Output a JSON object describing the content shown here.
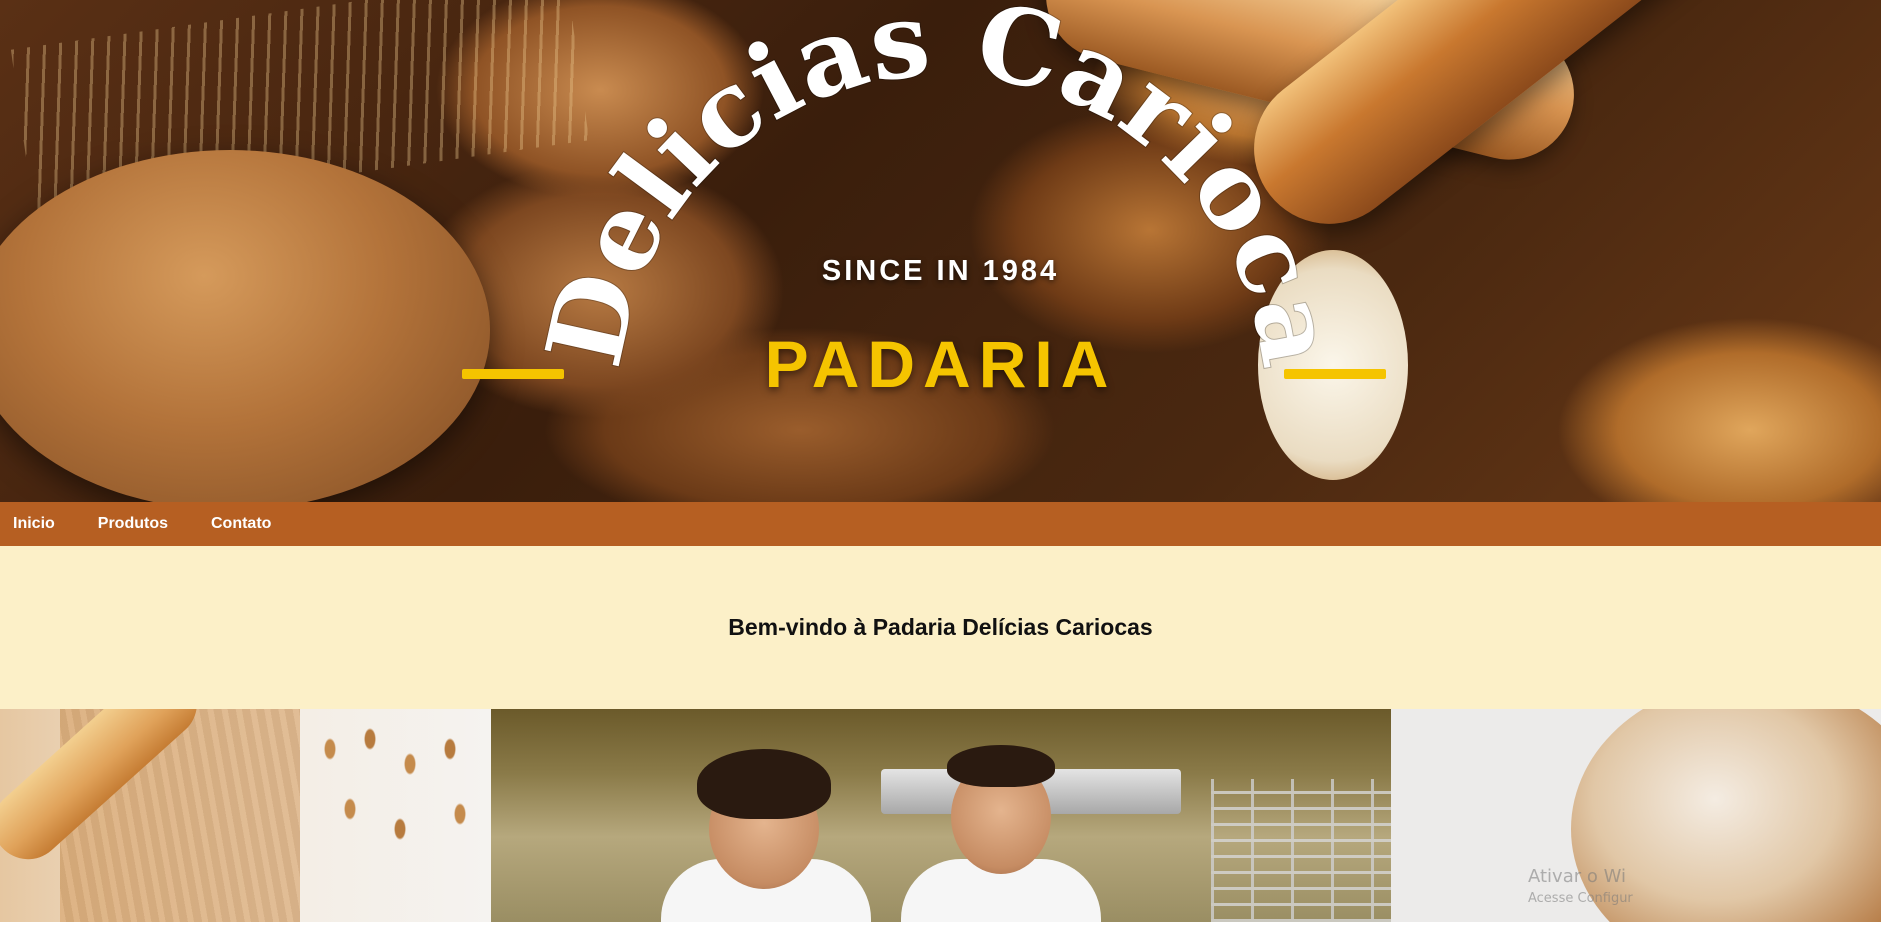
{
  "hero": {
    "brand_arc": "Delicias Carioca",
    "since": "SINCE IN 1984",
    "subtitle": "PADARIA"
  },
  "nav": {
    "items": [
      {
        "label": "Inicio"
      },
      {
        "label": "Produtos"
      },
      {
        "label": "Contato"
      }
    ]
  },
  "welcome": {
    "heading": "Bem-vindo à Padaria Delícias Cariocas"
  },
  "gallery": {
    "images": [
      "bread-and-wheat-photo",
      "bakers-photo",
      "rustic-loaf-photo"
    ]
  },
  "overlay": {
    "activate_title": "Ativar o Wi",
    "activate_sub": "Acesse Configur"
  },
  "colors": {
    "nav_bg": "#b65f22",
    "welcome_bg": "#fcf0c8",
    "accent_yellow": "#f5c400"
  }
}
